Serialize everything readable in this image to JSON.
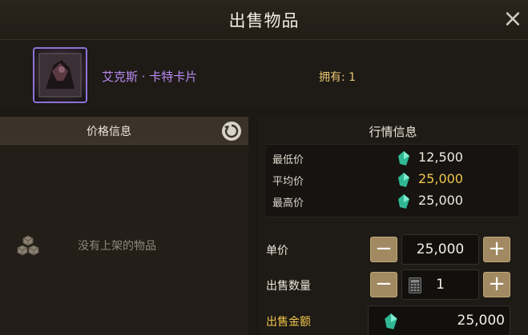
{
  "window": {
    "title": "出售物品",
    "close_label": "×"
  },
  "item": {
    "name": "艾克斯 · 卡特卡片",
    "owned": "拥有: 1"
  },
  "left_panel": {
    "title": "价格信息",
    "empty_text": "没有上架的物品"
  },
  "market": {
    "title": "行情信息",
    "rows": [
      {
        "label": "最低价",
        "value": "12,500"
      },
      {
        "label": "平均价",
        "value": "25,000"
      },
      {
        "label": "最高价",
        "value": "25,000"
      }
    ]
  },
  "form": {
    "unit_price_label": "单价",
    "unit_price_value": "25,000",
    "quantity_label": "出售数量",
    "quantity_value": "1",
    "total_label": "出售金额",
    "total_value": "25,000",
    "minus_label": "−",
    "plus_label": "+"
  },
  "colors": {
    "item_name": "#b98cf5",
    "owned": "#e8c670",
    "average_price": "#f0c64a",
    "gem": "#3fd6a8",
    "button": "#a18a62"
  },
  "icons": {
    "close": "close-icon",
    "refresh": "refresh-icon",
    "empty": "cube-stack-icon",
    "currency": "gem-icon",
    "calculator": "calculator-icon"
  }
}
